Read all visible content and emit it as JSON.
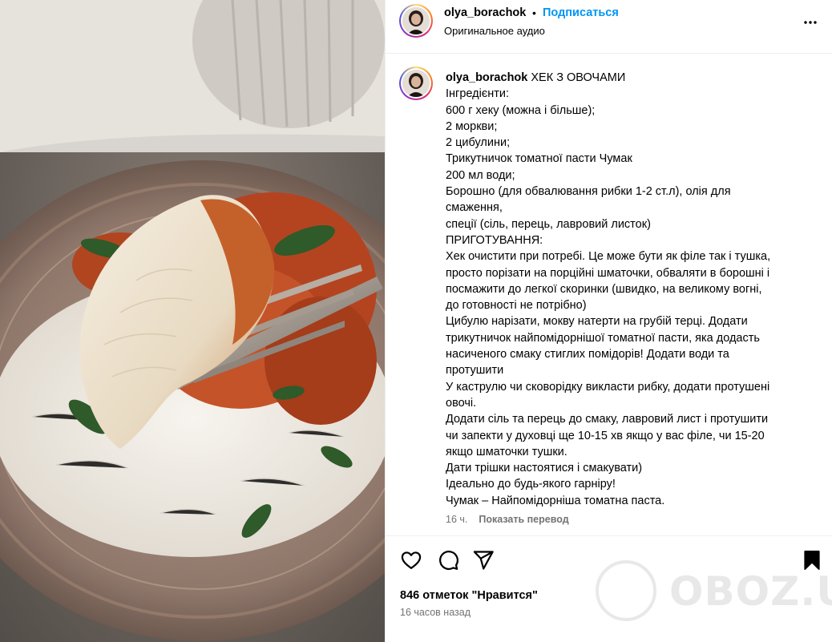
{
  "header": {
    "username": "olya_borachok",
    "separator": "•",
    "follow_label": "Подписаться",
    "audio": "Оригинальное аудио",
    "more_icon": "more-horizontal-icon"
  },
  "caption": {
    "username": "olya_borachok",
    "lines": [
      "ХЕК З ОВОЧАМИ",
      "Інгредієнти:",
      "600 г хеку (можна і більше);",
      "2 моркви;",
      "2 цибулини;",
      "Трикутничок томатної пасти Чумак",
      "200 мл води;",
      "Борошно (для обвалювання рибки 1-2 ст.л), олія для",
      "смаження,",
      "спеції (сіль, перець, лавровий листок)",
      "ПРИГОТУВАННЯ:",
      "Хек очистити при потребі. Це може бути як філе так і тушка,",
      "просто порізати на порційні шматочки, обваляти в борошні і",
      "посмажити до легкої скоринки (швидко, на великому вогні,",
      "до готовності не потрібно)",
      "Цибулю нарізати, мокву натерти на грубій терці. Додати",
      "трикутничок найпомідорнішої томатної пасти, яка додасть",
      "насиченого смаку стиглих помідорів! Додати води та",
      "протушити",
      "У каструлю чи сковорідку викласти рибку, додати протушені",
      "овочі.",
      "Додати сіль та перець до смаку, лавровий лист і протушити",
      "чи запекти у духовці ще 10-15 хв якщо у вас філе, чи 15-20",
      "якщо шматочки тушки.",
      "Дати трішки настоятися і смакувати)",
      "Ідеально до будь-якого гарніру!",
      "Чумак – Найпомідорніша томатна паста."
    ],
    "age": "16 ч.",
    "translate_label": "Показать перевод"
  },
  "actions": {
    "like_icon": "heart-icon",
    "comment_icon": "comment-icon",
    "share_icon": "share-icon",
    "save_icon": "bookmark-icon",
    "likes_text": "846 отметок \"Нравится\"",
    "posted_ago": "16 часов назад"
  },
  "watermark": {
    "text": "OBOZ.UA"
  }
}
